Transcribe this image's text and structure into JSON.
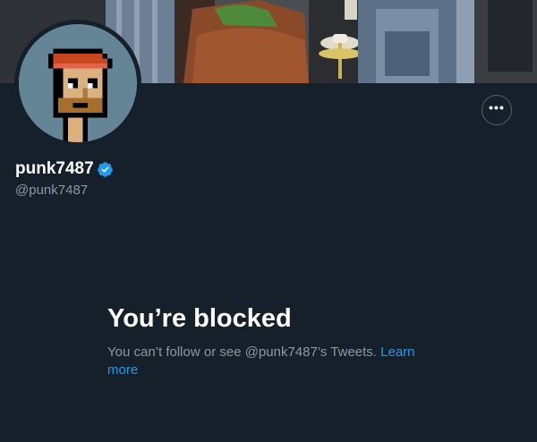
{
  "profile": {
    "display_name": "punk7487",
    "handle": "@punk7487",
    "verified_icon": "verified-badge-icon",
    "more_icon": "more-horizontal-icon",
    "more_label": "•••"
  },
  "blocked": {
    "title": "You’re blocked",
    "message": "You can’t follow or see @punk7487’s Tweets.",
    "link": "Learn more"
  },
  "colors": {
    "background": "#15202b",
    "accent": "#1d9bf0",
    "secondary_text": "#8b98a5",
    "avatar_background": "#638596",
    "beanie": "#c8471f"
  }
}
